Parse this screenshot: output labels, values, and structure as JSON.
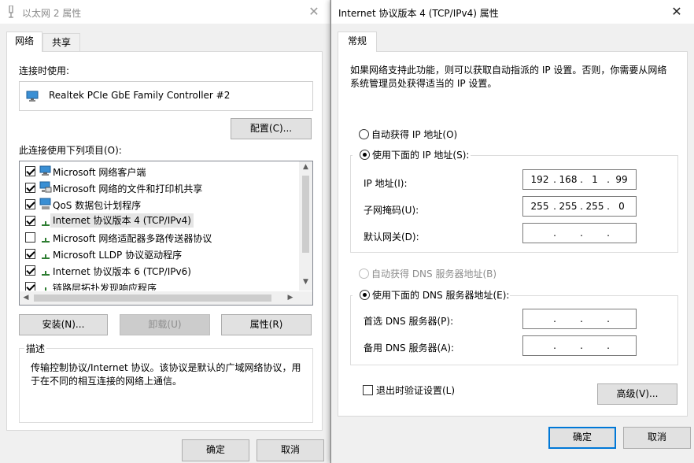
{
  "left_window": {
    "title": "以太网 2 属性",
    "tabs": [
      "网络",
      "共享"
    ],
    "connect_using_label": "连接时使用:",
    "adapter_name": "Realtek PCIe GbE Family Controller #2",
    "configure_button": "配置(C)...",
    "items_label": "此连接使用下列项目(O):",
    "items": [
      {
        "label": "Microsoft 网络客户端",
        "checked": true,
        "icon": "network-client-icon"
      },
      {
        "label": "Microsoft 网络的文件和打印机共享",
        "checked": true,
        "icon": "file-printer-share-icon"
      },
      {
        "label": "QoS 数据包计划程序",
        "checked": true,
        "icon": "qos-icon"
      },
      {
        "label": "Internet 协议版本 4 (TCP/IPv4)",
        "checked": true,
        "icon": "protocol-icon",
        "selected": true
      },
      {
        "label": "Microsoft 网络适配器多路传送器协议",
        "checked": false,
        "icon": "protocol-icon"
      },
      {
        "label": "Microsoft LLDP 协议驱动程序",
        "checked": true,
        "icon": "protocol-icon"
      },
      {
        "label": "Internet 协议版本 6 (TCP/IPv6)",
        "checked": true,
        "icon": "protocol-icon"
      },
      {
        "label": "链路层拓扑发现响应程序",
        "checked": true,
        "icon": "protocol-icon"
      }
    ],
    "install_button": "安装(N)...",
    "uninstall_button": "卸载(U)",
    "properties_button": "属性(R)",
    "description_title": "描述",
    "description_text": "传输控制协议/Internet 协议。该协议是默认的广域网络协议，用于在不同的相互连接的网络上通信。",
    "ok_button": "确定",
    "cancel_button": "取消"
  },
  "right_window": {
    "title": "Internet 协议版本 4 (TCP/IPv4) 属性",
    "tab": "常规",
    "intro_text": "如果网络支持此功能，则可以获取自动指派的 IP 设置。否则，你需要从网络系统管理员处获得适当的 IP 设置。",
    "auto_ip_label": "自动获得 IP 地址(O)",
    "manual_ip_label": "使用下面的 IP 地址(S):",
    "ip_address_label": "IP 地址(I):",
    "ip_address": [
      "192",
      "168",
      "1",
      "99"
    ],
    "subnet_label": "子网掩码(U):",
    "subnet_mask": [
      "255",
      "255",
      "255",
      "0"
    ],
    "gateway_label": "默认网关(D):",
    "gateway": [
      "",
      "",
      "",
      ""
    ],
    "auto_dns_label": "自动获得 DNS 服务器地址(B)",
    "manual_dns_label": "使用下面的 DNS 服务器地址(E):",
    "preferred_dns_label": "首选 DNS 服务器(P):",
    "preferred_dns": [
      "",
      "",
      "",
      ""
    ],
    "alternate_dns_label": "备用 DNS 服务器(A):",
    "alternate_dns": [
      "",
      "",
      "",
      ""
    ],
    "validate_label": "退出时验证设置(L)",
    "advanced_button": "高级(V)...",
    "ok_button": "确定",
    "cancel_button": "取消"
  }
}
